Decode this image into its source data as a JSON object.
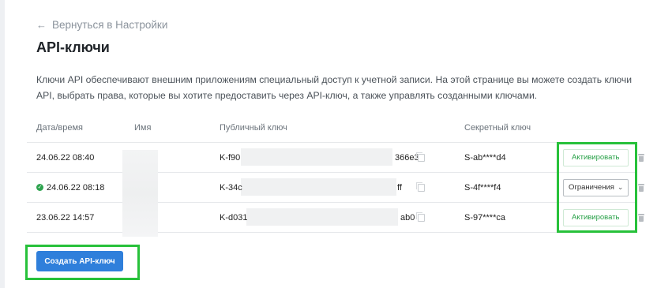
{
  "nav": {
    "back_label": "Вернуться в Настройки",
    "back_icon": "arrow-left-icon"
  },
  "page": {
    "title": "API-ключи",
    "description": "Ключи API обеспечивают внешним приложениям специальный доступ к учетной записи. На этой странице вы можете создать ключи API, выбрать права, которые вы хотите предоставить через API-ключ, а также управлять созданными ключами."
  },
  "table": {
    "columns": [
      "Дата/время",
      "Имя",
      "Публичный ключ",
      "Секретный ключ"
    ],
    "rows": [
      {
        "datetime": "24.06.22 08:40",
        "status_active": false,
        "public_start": "K-f90",
        "public_end": "366e3",
        "secret": "S-ab****d4",
        "action_label": "Активировать",
        "action_type": "activate"
      },
      {
        "datetime": "24.06.22 08:18",
        "status_active": true,
        "public_start": "K-34c",
        "public_end": "ff",
        "secret": "S-4f****f4",
        "action_label": "Ограничения",
        "action_type": "restrict"
      },
      {
        "datetime": "23.06.22 14:57",
        "status_active": false,
        "public_start": "K-d031",
        "public_end": "ab0",
        "secret": "S-97****ca",
        "action_label": "Активировать",
        "action_type": "activate"
      }
    ]
  },
  "create_button": {
    "label": "Создать API-ключ"
  },
  "colors": {
    "accent": "#2f7fdb",
    "success": "#27a047",
    "highlight": "#27c13a"
  }
}
